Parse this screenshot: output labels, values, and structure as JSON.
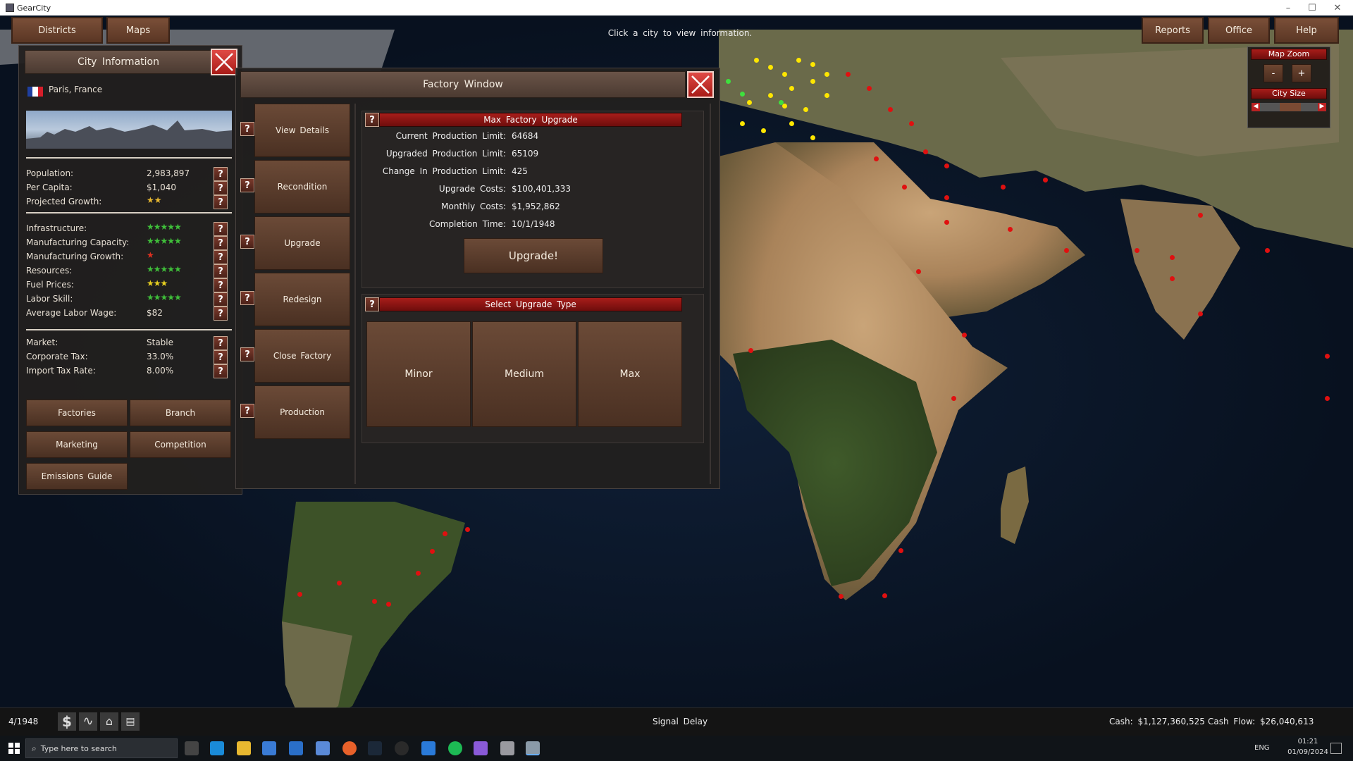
{
  "window": {
    "title": "GearCity"
  },
  "topbar": {
    "districts": "Districts",
    "maps": "Maps",
    "message": "Click a city to view information.",
    "reports": "Reports",
    "office": "Office",
    "help": "Help"
  },
  "zoom_panel": {
    "map_zoom": "Map Zoom",
    "minus": "-",
    "plus": "+",
    "city_size": "City Size"
  },
  "city_info": {
    "header": "City Information",
    "city": "Paris, France",
    "stats_a": [
      {
        "label": "Population:",
        "value": "2,983,897"
      },
      {
        "label": "Per Capita:",
        "value": "$1,040"
      },
      {
        "label": "Projected Growth:",
        "stars": "projected"
      }
    ],
    "stats_b": [
      {
        "label": "Infrastructure:",
        "rating": 5,
        "color": "green"
      },
      {
        "label": "Manufacturing Capacity:",
        "rating": 5,
        "color": "green"
      },
      {
        "label": "Manufacturing Growth:",
        "rating": 1,
        "color": "red"
      },
      {
        "label": "Resources:",
        "rating": 5,
        "color": "green"
      },
      {
        "label": "Fuel Prices:",
        "rating": 3,
        "color": "yellow"
      },
      {
        "label": "Labor Skill:",
        "rating": 5,
        "color": "green"
      },
      {
        "label": "Average Labor Wage:",
        "value": "$82"
      }
    ],
    "stats_c": [
      {
        "label": "Market:",
        "value": "Stable"
      },
      {
        "label": "Corporate Tax:",
        "value": "33.0%"
      },
      {
        "label": "Import Tax Rate:",
        "value": "8.00%"
      }
    ],
    "buttons": {
      "factories": "Factories",
      "branch": "Branch",
      "marketing": "Marketing",
      "competition": "Competition",
      "emissions": "Emissions Guide"
    }
  },
  "factory_window": {
    "header": "Factory Window",
    "side_buttons": [
      "View Details",
      "Recondition",
      "Upgrade",
      "Redesign",
      "Close Factory",
      "Production"
    ],
    "max_upgrade": {
      "title": "Max Factory Upgrade",
      "rows": [
        {
          "label": "Current Production Limit:",
          "value": "64684"
        },
        {
          "label": "Upgraded Production Limit:",
          "value": "65109"
        },
        {
          "label": "Change In Production Limit:",
          "value": "425"
        },
        {
          "label": "Upgrade Costs:",
          "value": "$100,401,333"
        },
        {
          "label": "Monthly Costs:",
          "value": "$1,952,862"
        },
        {
          "label": "Completion Time:",
          "value": "10/1/1948"
        }
      ],
      "upgrade_button": "Upgrade!"
    },
    "select_type": {
      "title": "Select Upgrade Type",
      "options": [
        "Minor",
        "Medium",
        "Max"
      ]
    }
  },
  "statusbar": {
    "date": "4/1948",
    "signal": "Signal Delay",
    "cash": "Cash: $1,127,360,525",
    "cashflow": "Cash Flow: $26,040,613"
  },
  "taskbar": {
    "search_placeholder": "Type here to search",
    "lang": "ENG",
    "time": "01:21",
    "date": "01/09/2024"
  }
}
